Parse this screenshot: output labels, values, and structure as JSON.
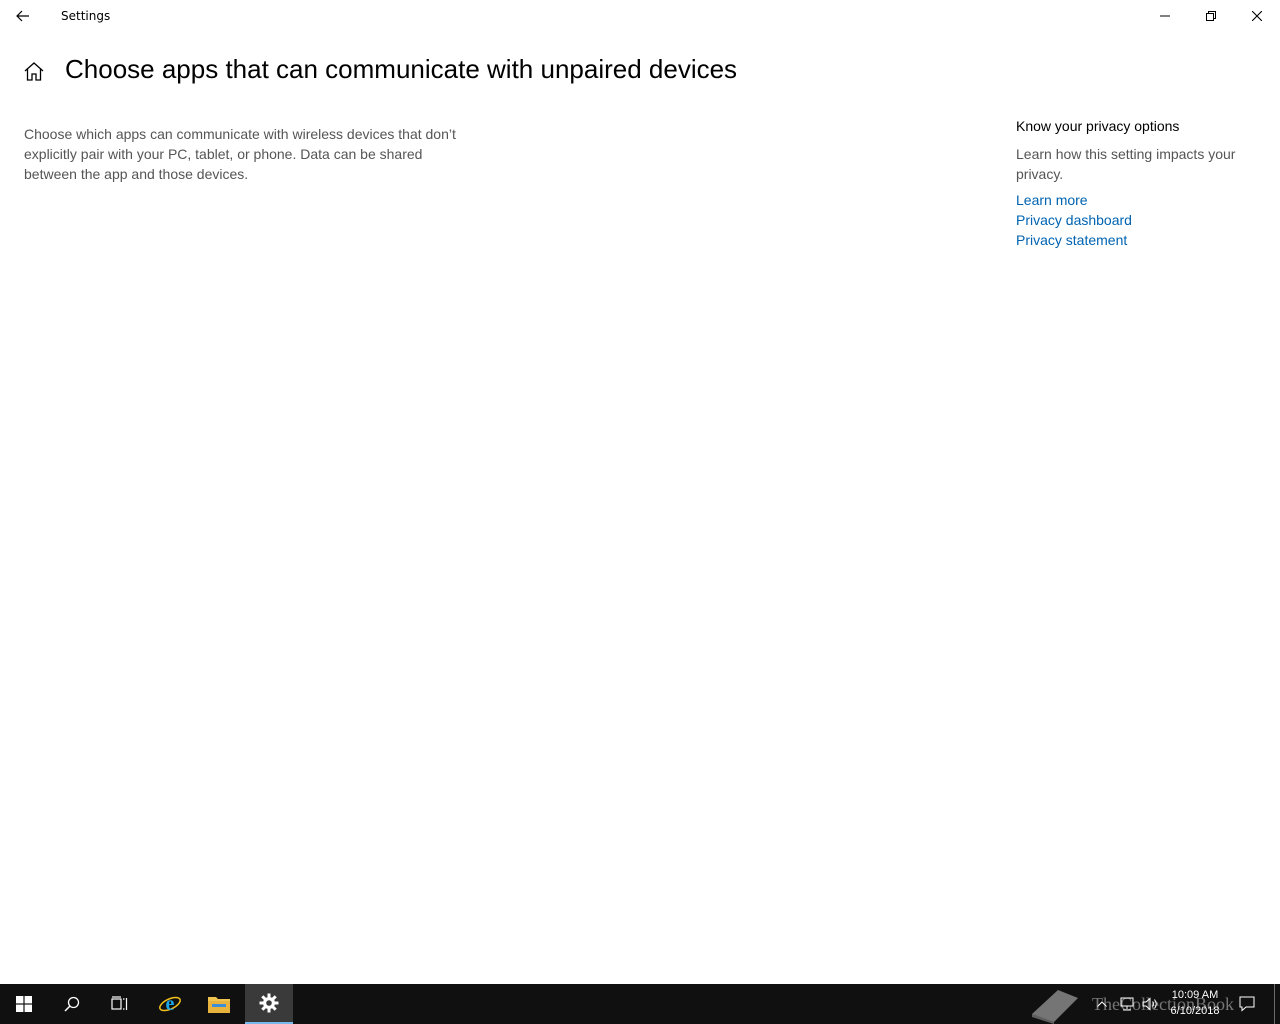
{
  "window": {
    "title": "Settings"
  },
  "page": {
    "title": "Choose apps that can communicate with unpaired devices",
    "description": "Choose which apps can communicate with wireless devices that don’t explicitly pair with your PC, tablet, or phone. Data can be shared between the app and those devices."
  },
  "side_panel": {
    "heading": "Know your privacy options",
    "text": "Learn how this setting impacts your privacy.",
    "links": [
      {
        "label": "Learn more"
      },
      {
        "label": "Privacy dashboard"
      },
      {
        "label": "Privacy statement"
      }
    ]
  },
  "taskbar": {
    "items": [
      {
        "icon": "windows-start-icon"
      },
      {
        "icon": "search-icon"
      },
      {
        "icon": "task-view-icon"
      },
      {
        "icon": "internet-explorer-icon"
      },
      {
        "icon": "file-explorer-icon"
      },
      {
        "icon": "settings-gear-icon",
        "active": true
      }
    ],
    "watermark": "TheCollectionBook",
    "clock": {
      "time": "10:09 AM",
      "date": "6/10/2018"
    }
  },
  "colors": {
    "link": "#0063b1",
    "secondary_text": "#555555",
    "taskbar_bg": "#101010",
    "active_indicator": "#76b9ed"
  }
}
